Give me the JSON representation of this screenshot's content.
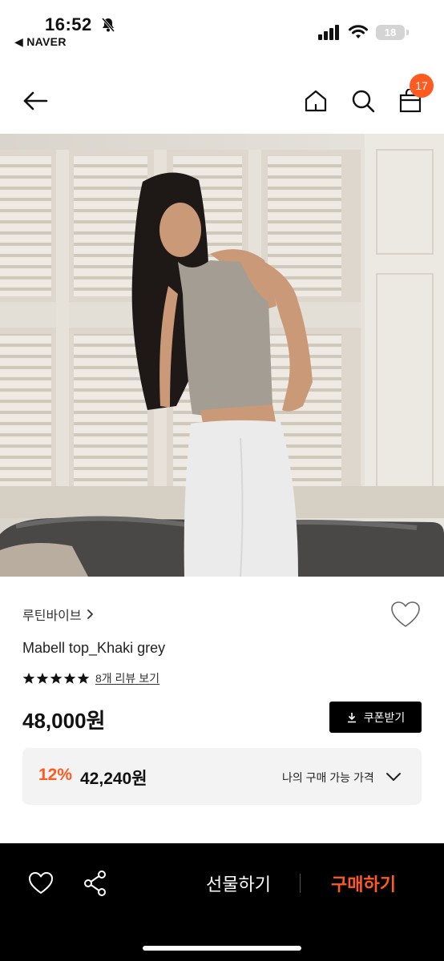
{
  "status_bar": {
    "time": "16:52",
    "back_app": "◀ NAVER",
    "battery": "18",
    "icons": [
      "bell-slash-icon",
      "signal-icon",
      "wifi-icon",
      "battery-icon"
    ]
  },
  "header": {
    "icons": [
      "back-arrow-icon",
      "home-icon",
      "search-icon",
      "bag-icon"
    ],
    "cart_count": "17"
  },
  "product": {
    "brand": "루틴바이브",
    "name": "Mabell top_Khaki grey",
    "rating_stars": 5,
    "reviews_link": "8개 리뷰 보기",
    "price": "48,000원",
    "coupon_label": "쿠폰받기",
    "discount": {
      "percent": "12%",
      "price": "42,240원",
      "label": "나의 구매 가능 가격"
    }
  },
  "bottom_bar": {
    "gift_label": "선물하기",
    "buy_label": "구매하기",
    "icons": [
      "heart-icon",
      "share-icon"
    ]
  },
  "colors": {
    "accent": "#ff5a1f",
    "bottom_bar_bg": "#000000",
    "discount_bg": "#f3f3f3"
  }
}
